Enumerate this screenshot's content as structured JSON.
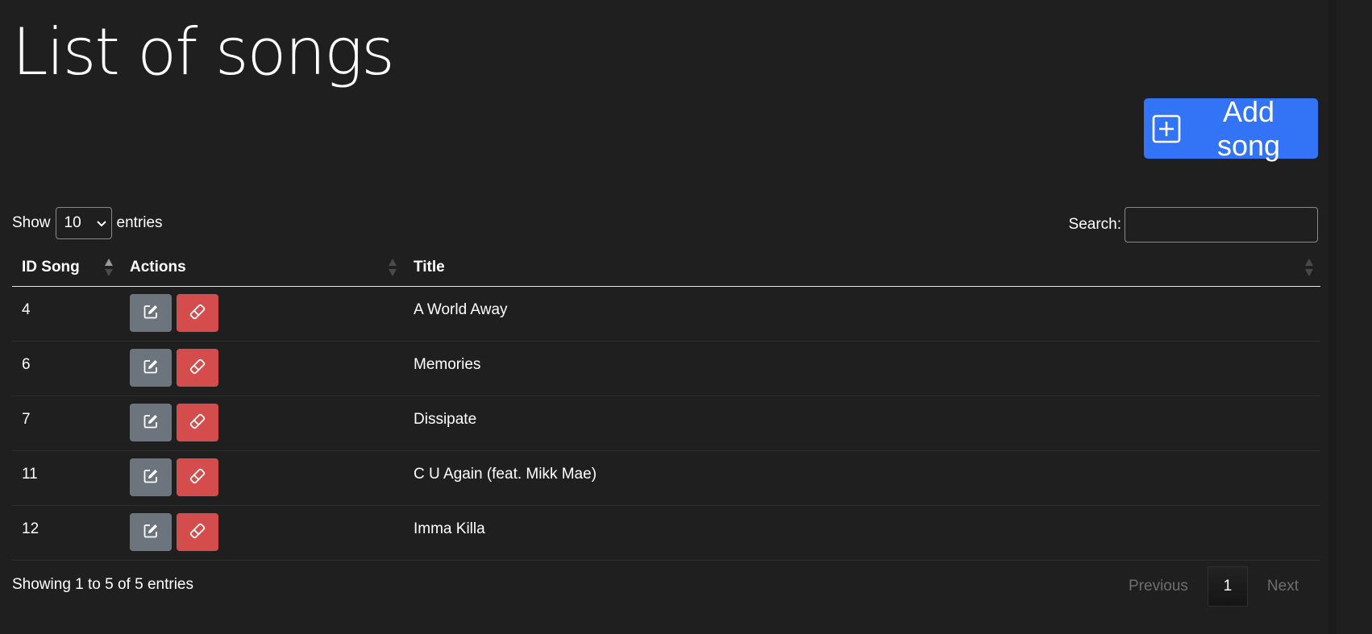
{
  "page": {
    "title": "List of songs"
  },
  "toolbar": {
    "add_label": "Add song"
  },
  "length": {
    "show_label": "Show",
    "selected": "10",
    "entries_label": "entries"
  },
  "search": {
    "label": "Search:",
    "value": ""
  },
  "table": {
    "columns": [
      "ID Song",
      "Actions",
      "Title"
    ],
    "rows": [
      {
        "id": "4",
        "title": "A World Away"
      },
      {
        "id": "6",
        "title": "Memories"
      },
      {
        "id": "7",
        "title": "Dissipate"
      },
      {
        "id": "11",
        "title": "C U Again (feat. Mikk Mae)"
      },
      {
        "id": "12",
        "title": "Imma Killa"
      }
    ]
  },
  "footer": {
    "info": "Showing 1 to 5 of 5 entries",
    "previous": "Previous",
    "current_page": "1",
    "next": "Next"
  },
  "colors": {
    "background": "#1f1f1f",
    "primary": "#3274f5",
    "edit": "#6c757d",
    "delete": "#d44c4c"
  },
  "icons": {
    "add": "plus-square-icon",
    "edit": "pencil-square-icon",
    "delete": "eraser-icon",
    "select": "chevron-down-icon",
    "sort": "sort-icon"
  }
}
